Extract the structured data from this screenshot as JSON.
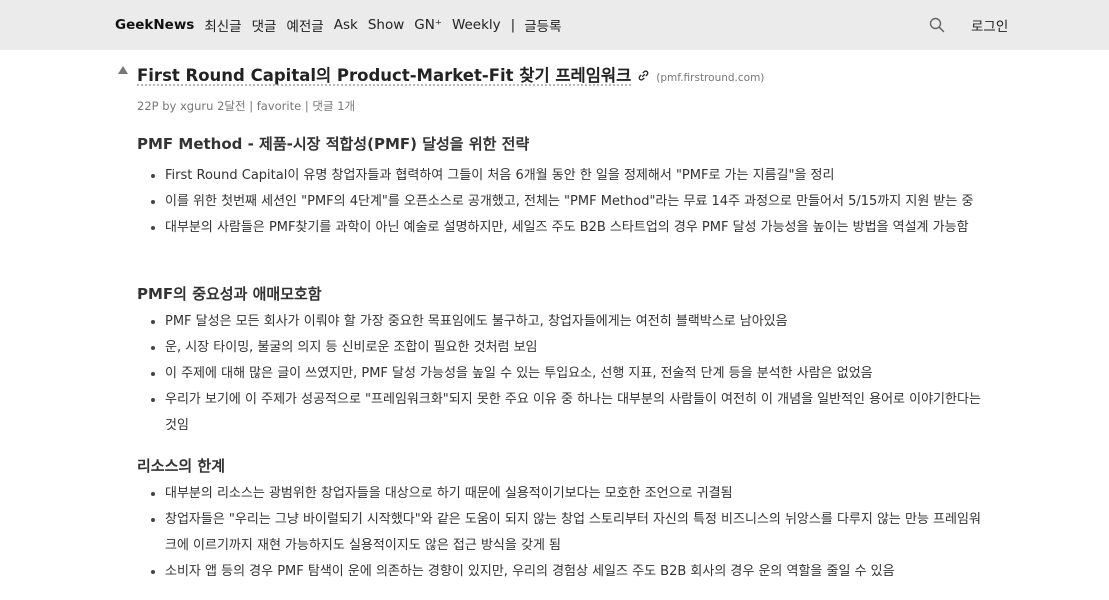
{
  "nav": {
    "brand": "GeekNews",
    "items": [
      "최신글",
      "댓글",
      "예전글",
      "Ask",
      "Show",
      "GN⁺",
      "Weekly"
    ],
    "separator": "|",
    "register": "글등록",
    "login": "로그인"
  },
  "post": {
    "title": "First Round Capital의 Product-Market-Fit 찾기 프레임워크",
    "domain": "(pmf.firstround.com)",
    "meta": {
      "points": "22P",
      "by": "by",
      "author": "xguru",
      "time": "2달전",
      "sep": "|",
      "favorite": "favorite",
      "comments": "댓글 1개"
    }
  },
  "sections": [
    {
      "heading": "PMF Method - 제품-시장 적합성(PMF) 달성을 위한 전략",
      "bullets": [
        "First Round Capital이 유명 창업자들과 협력하여 그들이 처음 6개월 동안 한 일을 정제해서 \"PMF로 가는 지름길\"을 정리",
        "이를 위한 첫번째 세션인 \"PMF의 4단계\"를 오픈소스로 공개했고, 전체는 \"PMF Method\"라는 무료 14주 과정으로 만들어서 5/15까지 지원 받는 중",
        "대부분의 사람들은 PMF찾기를 과학이 아닌 예술로 설명하지만, 세일즈 주도 B2B 스타트업의 경우 PMF 달성 가능성을 높이는 방법을 역설계 가능함"
      ]
    },
    {
      "heading": "PMF의 중요성과 애매모호함",
      "bullets": [
        "PMF 달성은 모든 회사가 이뤄야 할 가장 중요한 목표임에도 불구하고, 창업자들에게는 여전히 블랙박스로 남아있음",
        "운, 시장 타이밍, 불굴의 의지 등 신비로운 조합이 필요한 것처럼 보임",
        "이 주제에 대해 많은 글이 쓰였지만, PMF 달성 가능성을 높일 수 있는 투입요소, 선행 지표, 전술적 단계 등을 분석한 사람은 없었음",
        "우리가 보기에 이 주제가 성공적으로 \"프레임워크화\"되지 못한 주요 이유 중 하나는 대부분의 사람들이 여전히 이 개념을 일반적인 용어로 이야기한다는 것임"
      ]
    },
    {
      "heading": "리소스의 한계",
      "bullets": [
        "대부분의 리소스는 광범위한 창업자들을 대상으로 하기 때문에 실용적이기보다는 모호한 조언으로 귀결됨",
        "창업자들은 \"우리는 그냥 바이럴되기 시작했다\"와 같은 도움이 되지 않는 창업 스토리부터 자신의 특정 비즈니스의 뉘앙스를 다루지 않는 만능 프레임워크에 이르기까지 재현 가능하지도 실용적이지도 않은 접근 방식을 갖게 됨",
        "소비자 앱 등의 경우 PMF 탐색이 운에 의존하는 경향이 있지만, 우리의 경험상 세일즈 주도 B2B 회사의 경우 운의 역할을 줄일 수 있음"
      ]
    }
  ]
}
